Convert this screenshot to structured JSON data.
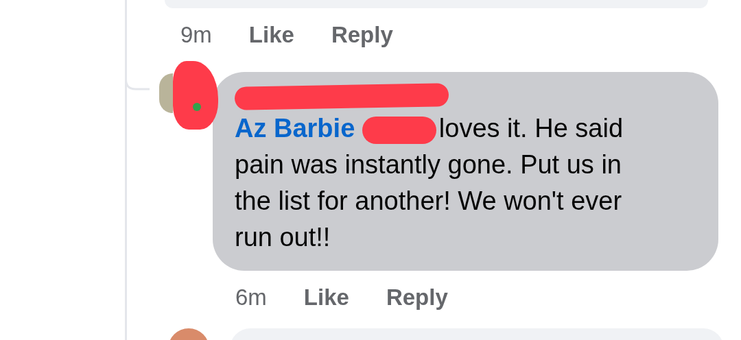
{
  "previous_comment": {
    "actions": {
      "time": "9m",
      "like": "Like",
      "reply": "Reply"
    }
  },
  "comment": {
    "author_online": true,
    "author_redacted": true,
    "mention": "Az Barbie",
    "mention_redacted": true,
    "text": "loves it. He said pain was instantly gone. Put us in the list for another! We won't ever run out!!",
    "actions": {
      "time": "6m",
      "like": "Like",
      "reply": "Reply"
    }
  },
  "next_comment": {
    "partial": true
  }
}
